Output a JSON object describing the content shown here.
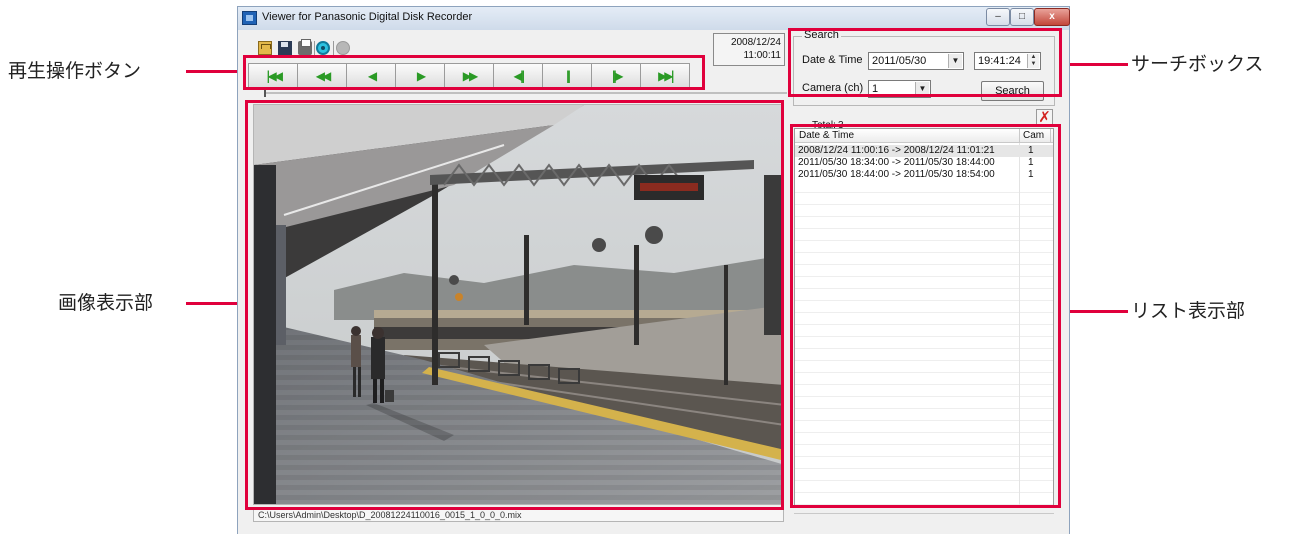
{
  "window": {
    "title": "Viewer for Panasonic Digital Disk Recorder",
    "minimize_icon": "minimize-icon",
    "maximize_icon": "maximize-icon",
    "close_label": "x"
  },
  "toolbar": {
    "icons": [
      "folder-open-icon",
      "save-icon",
      "print-icon",
      "zoom-icon",
      "record-icon"
    ]
  },
  "display": {
    "date": "2008/12/24",
    "time": "11:00:11"
  },
  "playback": {
    "buttons": [
      {
        "name": "skip-to-start",
        "glyph": "|◀◀"
      },
      {
        "name": "fast-reverse",
        "glyph": "◀◀"
      },
      {
        "name": "reverse-play",
        "glyph": "◀"
      },
      {
        "name": "play",
        "glyph": "▶"
      },
      {
        "name": "fast-forward",
        "glyph": "▶▶"
      },
      {
        "name": "frame-reverse",
        "glyph": "◀||"
      },
      {
        "name": "pause",
        "glyph": "||"
      },
      {
        "name": "frame-forward",
        "glyph": "||▶"
      },
      {
        "name": "skip-to-end",
        "glyph": "▶▶|"
      }
    ]
  },
  "image": {
    "status": "C:\\Users\\Admin\\Desktop\\D_20081224110016_0015_1_0_0_0.mix"
  },
  "search": {
    "group_label": "Search",
    "datetime_label": "Date & Time",
    "date_value": "2011/05/30",
    "time_value": "19:41:24",
    "camera_label": "Camera (ch)",
    "camera_value": "1",
    "search_button": "Search"
  },
  "list": {
    "total_label": "Total:",
    "total_value": "3",
    "delete_icon": "delete-x-icon",
    "columns": [
      "Date & Time",
      "Cam"
    ],
    "rows": [
      {
        "datetime": "2008/12/24 11:00:16 -> 2008/12/24 11:01:21",
        "cam": "1"
      },
      {
        "datetime": "2011/05/30 18:34:00 -> 2011/05/30 18:44:00",
        "cam": "1"
      },
      {
        "datetime": "2011/05/30 18:44:00 -> 2011/05/30 18:54:00",
        "cam": "1"
      }
    ]
  },
  "annotations": {
    "playback_buttons": "再生操作ボタン",
    "image_display": "画像表示部",
    "search_box": "サーチボックス",
    "list_display": "リスト表示部"
  },
  "colors": {
    "highlight": "#e0003c",
    "playback_icon": "#2a9a25",
    "delete_icon": "#d2231f"
  }
}
